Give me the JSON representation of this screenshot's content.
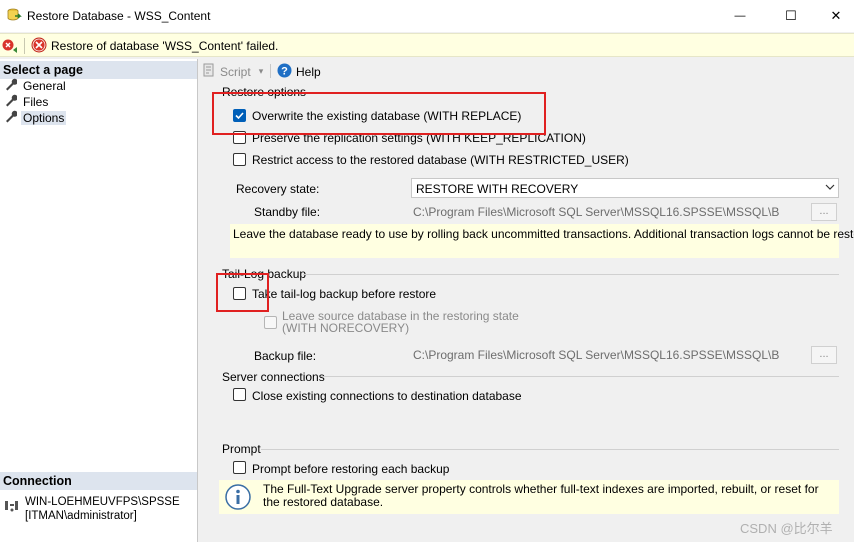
{
  "window": {
    "title": "Restore Database - WSS_Content",
    "minimize_glyph": "—",
    "maximize_glyph": "☐",
    "close_glyph": "✕"
  },
  "error_bar": {
    "message": "Restore of database 'WSS_Content' failed."
  },
  "left_pane": {
    "select_page_header": "Select a page",
    "pages": [
      {
        "label": "General",
        "icon": "wrench-icon",
        "selected": false
      },
      {
        "label": "Files",
        "icon": "wrench-icon",
        "selected": false
      },
      {
        "label": "Options",
        "icon": "wrench-icon",
        "selected": true
      }
    ],
    "connection_header": "Connection",
    "connection": {
      "server": "WIN-LOEHMEUVFPS\\SPSSE",
      "user": "[ITMAN\\administrator]"
    }
  },
  "toolbar": {
    "script_label": "Script",
    "help_label": "Help"
  },
  "restore_options": {
    "group_label": "Restore options",
    "overwrite": {
      "label": "Overwrite the existing database (WITH REPLACE)",
      "checked": true
    },
    "preserve": {
      "label": "Preserve the replication settings (WITH KEEP_REPLICATION)",
      "checked": false
    },
    "restrict": {
      "label": "Restrict access to the restored database (WITH RESTRICTED_USER)",
      "checked": false
    },
    "recovery_state_label": "Recovery state:",
    "recovery_state_value": "RESTORE WITH RECOVERY",
    "standby_file_label": "Standby file:",
    "standby_file_value": "C:\\Program Files\\Microsoft SQL Server\\MSSQL16.SPSSE\\MSSQL\\Backup\\",
    "browse_label": "...",
    "description": "Leave the database ready to use by rolling back uncommitted transactions. Additional transaction logs cannot be restored."
  },
  "tail_log": {
    "group_label": "Tail-Log backup",
    "take_backup": {
      "label": "Take tail-log backup before restore",
      "checked": false
    },
    "leave_source_line1": "Leave source database in the restoring state",
    "leave_source_line2": "(WITH NORECOVERY)",
    "backup_file_label": "Backup file:",
    "backup_file_value": "C:\\Program Files\\Microsoft SQL Server\\MSSQL16.SPSSE\\MSSQL\\Backup\\",
    "browse_label": "..."
  },
  "server_connections": {
    "group_label": "Server connections",
    "close_existing": {
      "label": "Close existing connections to destination database",
      "checked": false
    }
  },
  "prompt": {
    "group_label": "Prompt",
    "prompt_before": {
      "label": "Prompt before restoring each backup",
      "checked": false
    },
    "info_text": "The Full-Text Upgrade server property controls whether full-text indexes are imported, rebuilt, or reset for the restored database."
  },
  "watermark": "CSDN @比尔羊",
  "colors": {
    "accent": "#005fb8",
    "error_bg": "#ffffe1",
    "highlight_box": "#e02020"
  }
}
